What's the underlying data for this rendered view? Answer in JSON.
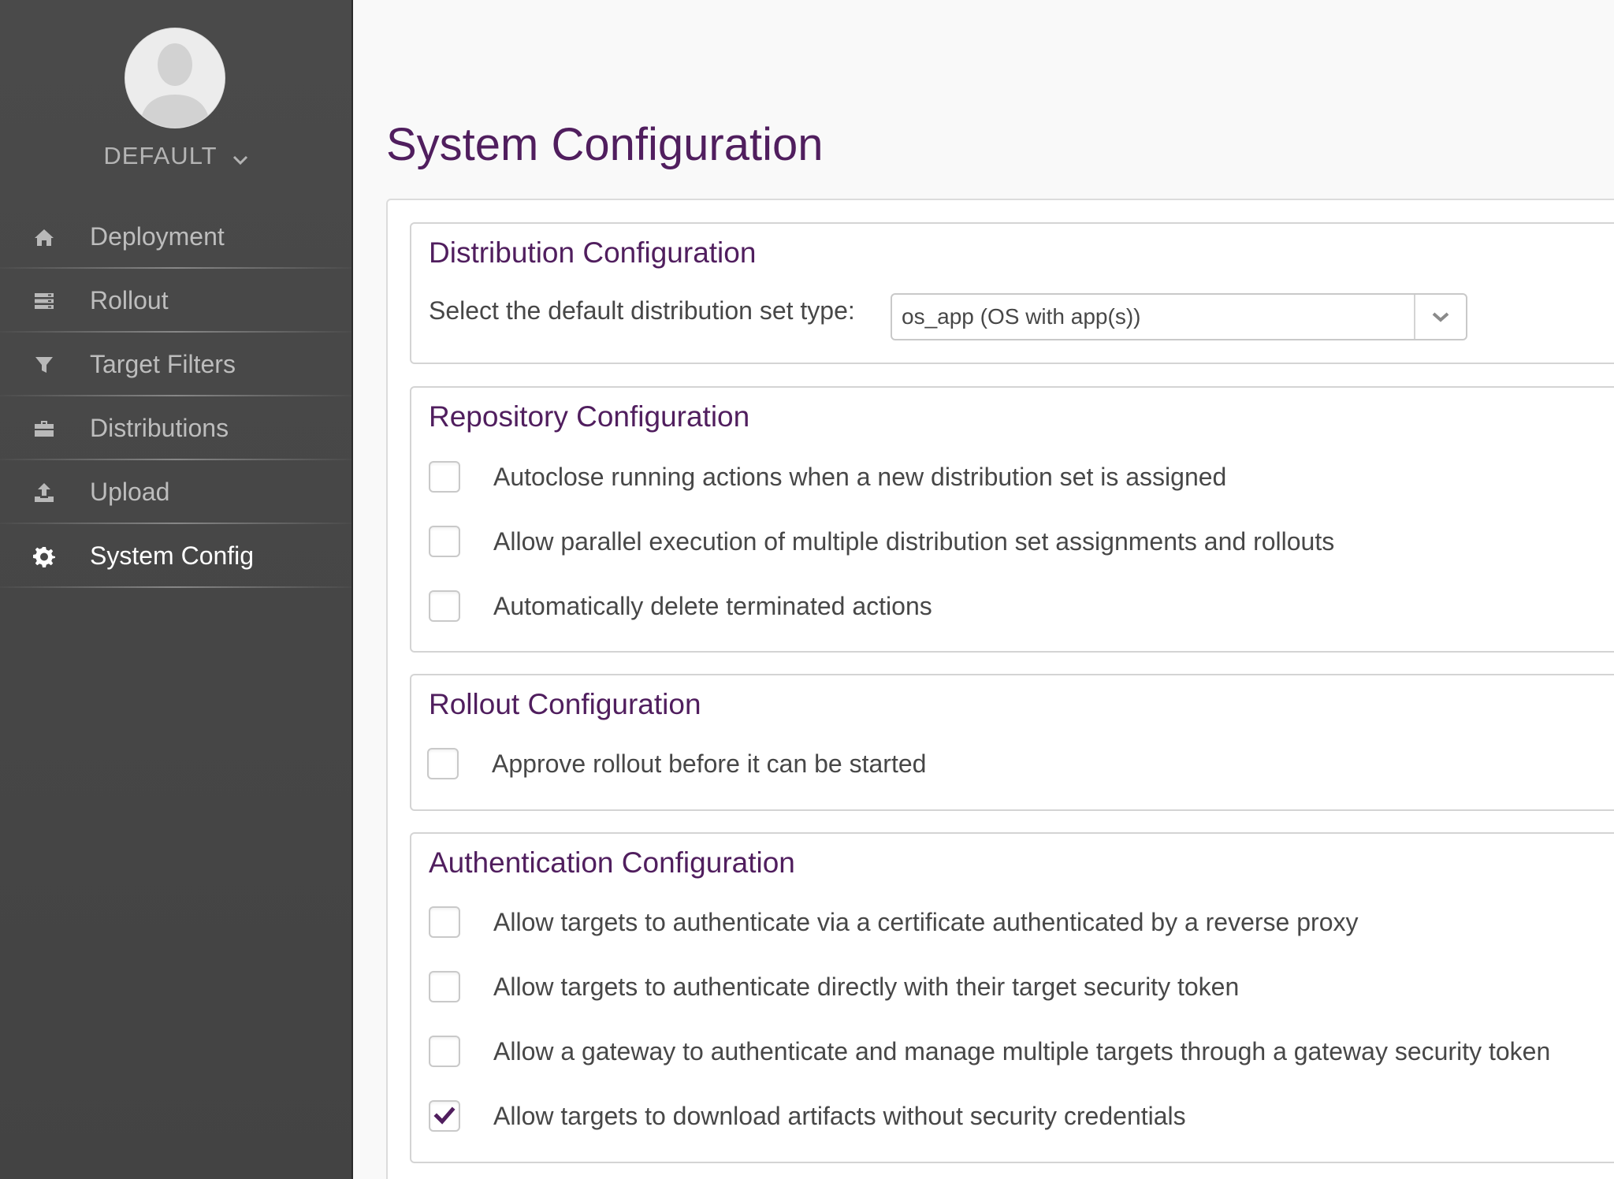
{
  "sidebar": {
    "tenant": "DEFAULT",
    "items": [
      {
        "label": "Deployment",
        "icon": "home-icon"
      },
      {
        "label": "Rollout",
        "icon": "server-stack-icon"
      },
      {
        "label": "Target Filters",
        "icon": "filter-icon"
      },
      {
        "label": "Distributions",
        "icon": "briefcase-icon"
      },
      {
        "label": "Upload",
        "icon": "upload-icon"
      },
      {
        "label": "System Config",
        "icon": "gear-icon",
        "active": true
      }
    ]
  },
  "page": {
    "title": "System Configuration"
  },
  "distribution": {
    "title": "Distribution Configuration",
    "select_label": "Select the default distribution set type:",
    "selected_value": "os_app (OS with app(s))"
  },
  "repository": {
    "title": "Repository Configuration",
    "options": [
      {
        "label": "Autoclose running actions when a new distribution set is assigned",
        "checked": false
      },
      {
        "label": "Allow parallel execution of multiple distribution set assignments and rollouts",
        "checked": false
      },
      {
        "label": "Automatically delete terminated actions",
        "checked": false
      }
    ]
  },
  "rollout": {
    "title": "Rollout Configuration",
    "options": [
      {
        "label": "Approve rollout before it can be started",
        "checked": false
      }
    ]
  },
  "authentication": {
    "title": "Authentication Configuration",
    "options": [
      {
        "label": "Allow targets to authenticate via a certificate authenticated by a reverse proxy",
        "checked": false
      },
      {
        "label": "Allow targets to authenticate directly with their target security token",
        "checked": false
      },
      {
        "label": "Allow a gateway to authenticate and manage multiple targets through a gateway security token",
        "checked": false
      },
      {
        "label": "Allow targets to download artifacts without security credentials",
        "checked": true
      }
    ]
  },
  "colors": {
    "accent": "#501e5e",
    "sidebar_bg": "#484848",
    "check": "#501e5e"
  }
}
